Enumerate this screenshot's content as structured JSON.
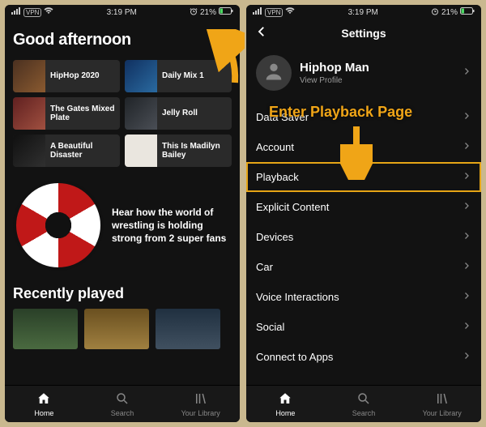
{
  "statusbar": {
    "time": "3:19 PM",
    "vpn": "VPN",
    "battery": "21%"
  },
  "home": {
    "greeting": "Good afternoon",
    "tiles": [
      {
        "label": "HipHop 2020"
      },
      {
        "label": "Daily Mix 1"
      },
      {
        "label": "The Gates Mixed Plate"
      },
      {
        "label": "Jelly Roll"
      },
      {
        "label": "A Beautiful Disaster"
      },
      {
        "label": "This Is Madilyn Bailey"
      }
    ],
    "promo": "Hear how the world of wrestling is holding strong from 2 super fans",
    "recent_title": "Recently played"
  },
  "settings": {
    "title": "Settings",
    "profile_name": "Hiphop Man",
    "profile_sub": "View Profile",
    "items": [
      {
        "label": "Data Saver"
      },
      {
        "label": "Account"
      },
      {
        "label": "Playback"
      },
      {
        "label": "Explicit Content"
      },
      {
        "label": "Devices"
      },
      {
        "label": "Car"
      },
      {
        "label": "Voice Interactions"
      },
      {
        "label": "Social"
      },
      {
        "label": "Connect to Apps"
      }
    ]
  },
  "nav": {
    "home": "Home",
    "search": "Search",
    "library": "Your Library"
  },
  "annotation": {
    "text": "Enter Playback Page"
  }
}
